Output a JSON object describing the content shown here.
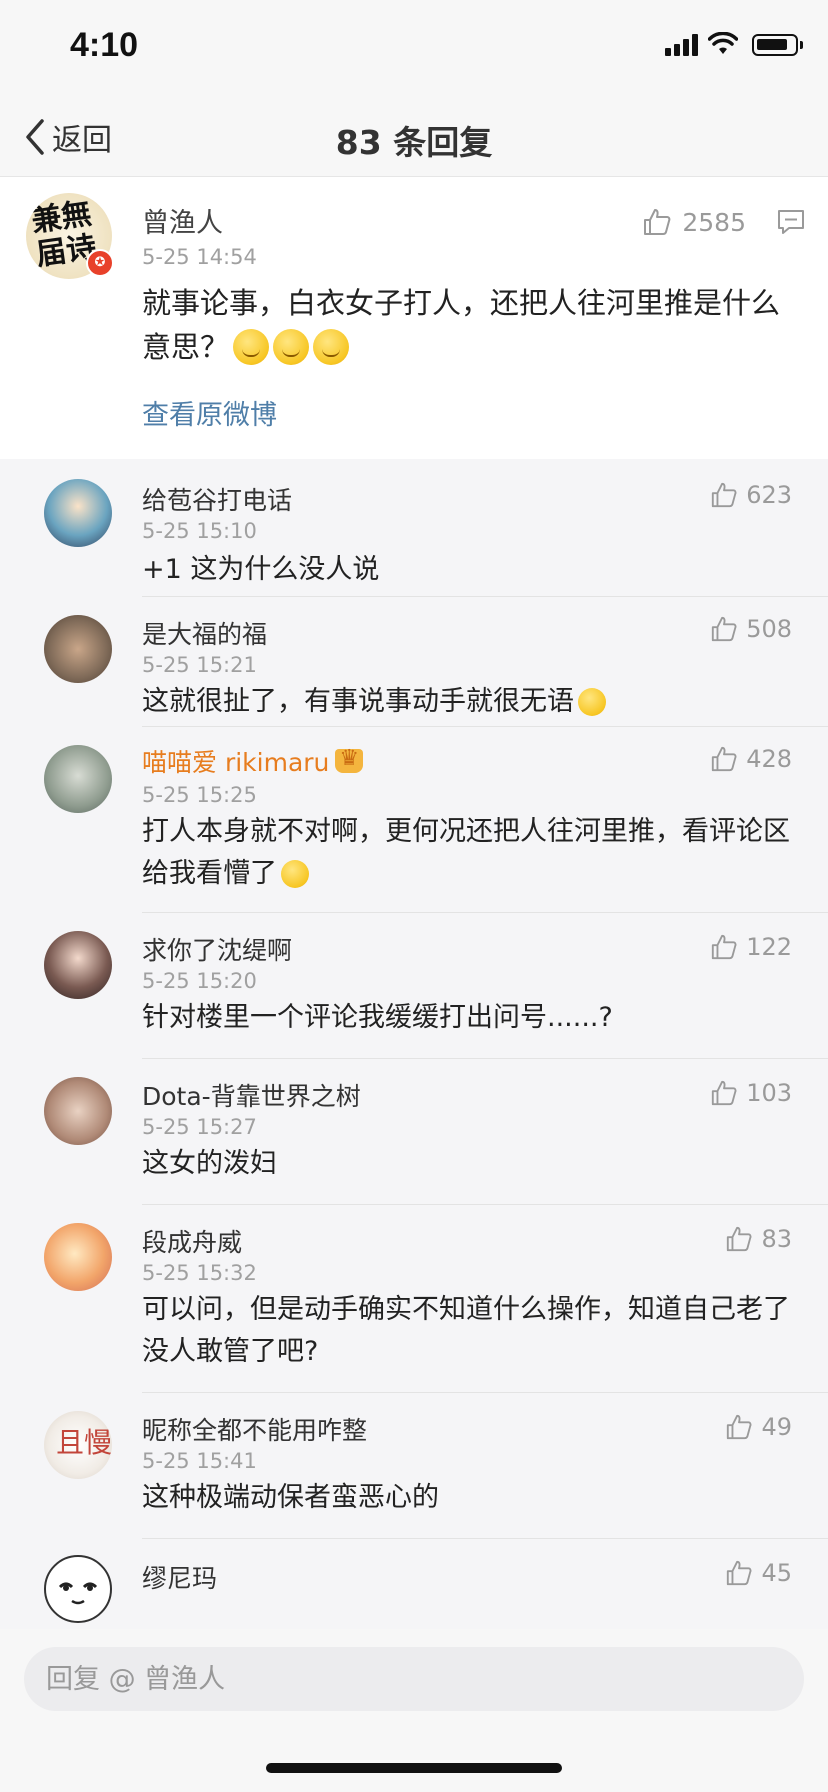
{
  "status_bar": {
    "time": "4:10"
  },
  "nav": {
    "back_label": "返回",
    "title": "83 条回复"
  },
  "main_comment": {
    "author": "曾渔人",
    "avatar_text": "兼無届诗",
    "time": "5-25 14:54",
    "text": "就事论事，白衣女子打人，还把人往河里推是什么意思？",
    "emoji_count": 3,
    "likes": "2585",
    "view_original_label": "查看原微博"
  },
  "replies": [
    {
      "name": "给苞谷打电话",
      "time": "5-25 15:10",
      "text": "+1 这为什么没人说",
      "likes": "623",
      "vip": false,
      "emoji": false
    },
    {
      "name": "是大福的福",
      "time": "5-25 15:21",
      "text": "这就很扯了，有事说事动手就很无语",
      "likes": "508",
      "vip": false,
      "emoji": true
    },
    {
      "name": "喵喵爱 rikimaru",
      "time": "5-25 15:25",
      "text": "打人本身就不对啊，更何况还把人往河里推，看评论区给我看懵了",
      "likes": "428",
      "vip": true,
      "emoji": true
    },
    {
      "name": "求你了沈缇啊",
      "time": "5-25 15:20",
      "text": "针对楼里一个评论我缓缓打出问号......?",
      "likes": "122",
      "vip": false,
      "emoji": false
    },
    {
      "name": "Dota-背靠世界之树",
      "time": "5-25 15:27",
      "text": "这女的泼妇",
      "likes": "103",
      "vip": false,
      "emoji": false
    },
    {
      "name": "段成舟威",
      "time": "5-25 15:32",
      "text": "可以问，但是动手确实不知道什么操作，知道自己老了没人敢管了吧?",
      "likes": "83",
      "vip": false,
      "emoji": false
    },
    {
      "name": "昵称全都不能用咋整",
      "time": "5-25 15:41",
      "text": "这种极端动保者蛮恶心的",
      "likes": "49",
      "vip": false,
      "emoji": false
    },
    {
      "name": "缪尼玛",
      "time": "",
      "text": "",
      "likes": "45",
      "vip": false,
      "emoji": false
    }
  ],
  "reply_input": {
    "placeholder": "回复 @ 曾渔人"
  },
  "colors": {
    "link": "#4f7ea8",
    "vip_name": "#e77d1f",
    "muted": "#a0a0a0",
    "background": "#f5f5f7"
  }
}
